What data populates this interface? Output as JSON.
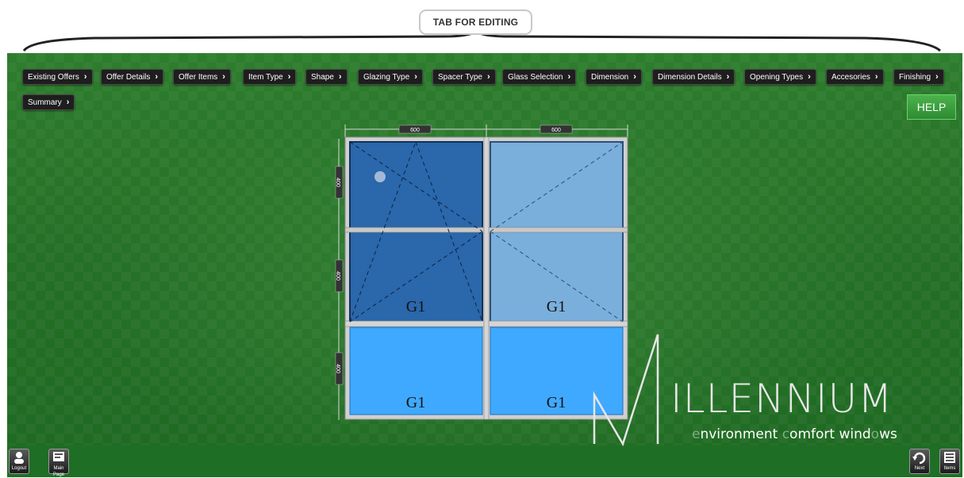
{
  "callout": {
    "label": "TAB FOR EDITING"
  },
  "tabs": [
    "Existing Offers",
    "Offer Details",
    "Offer Items",
    "Item Type",
    "Shape",
    "Glazing Type",
    "Spacer Type",
    "Glass Selection",
    "Dimension",
    "Dimension Details",
    "Opening Types",
    "Accesories",
    "Finishing",
    "Summary"
  ],
  "help": {
    "label": "HELP"
  },
  "window": {
    "widths": [
      "600",
      "600"
    ],
    "heights": [
      "400",
      "400",
      "400"
    ],
    "panes": [
      "G1",
      "G1",
      "G1",
      "G1"
    ]
  },
  "logo": {
    "word": "ILLENNIUM",
    "tagline_1a": "e",
    "tagline_1b": "nvironment ",
    "tagline_2a": "c",
    "tagline_2b": "omfort wind",
    "tagline_3a": "o",
    "tagline_3b": "ws"
  },
  "bottom": {
    "logout": "Logout",
    "main_page": "Main Page",
    "next": "Next",
    "items": "Items"
  },
  "colors": {
    "pane_dark": "#2a67ab",
    "pane_light": "#7aaedb",
    "pane_blue": "#3fa9ff",
    "frame": "#c8c8c8"
  }
}
